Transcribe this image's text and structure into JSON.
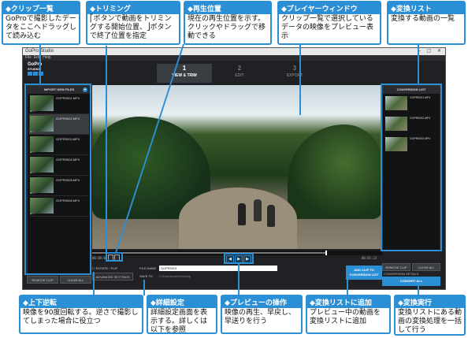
{
  "window": {
    "title": "GoPro Studio",
    "menu": [
      "File",
      "Edit",
      "Help"
    ],
    "logo_top": "GoPro",
    "logo_bottom": "STUDIO"
  },
  "tabs": [
    {
      "num": "1",
      "label": "VIEW & TRIM",
      "active": true
    },
    {
      "num": "2",
      "label": "EDIT",
      "active": false
    },
    {
      "num": "3",
      "label": "EXPORT",
      "active": false
    }
  ],
  "import_panel": {
    "header": "IMPORT NEW FILES",
    "clips": [
      {
        "name": "GOPR0001.MP4"
      },
      {
        "name": "GOPR0002.MP4"
      },
      {
        "name": "GOPR0003.MP4"
      },
      {
        "name": "GOPR0004.MP4"
      },
      {
        "name": "GOPR0005.MP4"
      },
      {
        "name": "GOPR0006.MP4"
      }
    ],
    "remove_clip": "REMOVE CLIP",
    "clear_all": "CLEAR ALL"
  },
  "player": {
    "timecode_left": "00:00:00",
    "timecode_right": "00:01:23",
    "flip_label": "ROTATE / FLIP",
    "advanced_settings": "ADVANCED SETTINGS",
    "file_name_label": "FILE NAME",
    "file_name_value": "GOPR0001",
    "save_to_label": "SAVE TO",
    "save_to_value": "C:\\Users\\user\\Desktop",
    "add_clip": "ADD CLIP TO CONVERSION LIST"
  },
  "conversion_panel": {
    "header": "CONVERSION LIST",
    "clips": [
      {
        "name": "GOPR0001.MP4"
      },
      {
        "name": "GOPR0002.MP4"
      },
      {
        "name": "GOPR0003.MP4"
      }
    ],
    "remove_clip": "REMOVE CLIP",
    "clear_all": "CLEAR ALL",
    "conversion_details": "CONVERSION DETAILS",
    "convert_all": "CONVERT ALL"
  },
  "callouts": {
    "clip_list": {
      "head": "◆クリップ一覧",
      "body": "GoProで撮影したデータをここへドラッグして読み込む"
    },
    "trimming": {
      "head": "◆トリミング",
      "body": "⎡ボタンで動画をトリミングする開始位置、⎦ボタンで終了位置を指定"
    },
    "playhead": {
      "head": "◆再生位置",
      "body": "現在の再生位置を示す。クリックやドラッグで移動できる"
    },
    "player_window": {
      "head": "◆プレイヤーウィンドウ",
      "body": "クリップ一覧で選択しているデータの映像をプレビュー表示"
    },
    "convert_list": {
      "head": "◆変換リスト",
      "body": "変換する動画の一覧"
    },
    "flip": {
      "head": "◆上下逆転",
      "body": "映像を90度回転する。逆さで撮影してしまった場合に役立つ"
    },
    "advanced": {
      "head": "◆詳細設定",
      "body": "詳細設定画面を表示する。詳しくは以下を参照"
    },
    "preview_ops": {
      "head": "◆プレビューの操作",
      "body": "映像の再生、早戻し、早送りを行う"
    },
    "add_to_list": {
      "head": "◆変換リストに追加",
      "body": "プレビュー中の動画を変換リストに追加"
    },
    "run_convert": {
      "head": "◆変換実行",
      "body": "変換リストにある動画の変換処理を一括して行う"
    }
  },
  "colors": {
    "accent": "#2b8fd6",
    "app_bg": "#1f2124"
  }
}
